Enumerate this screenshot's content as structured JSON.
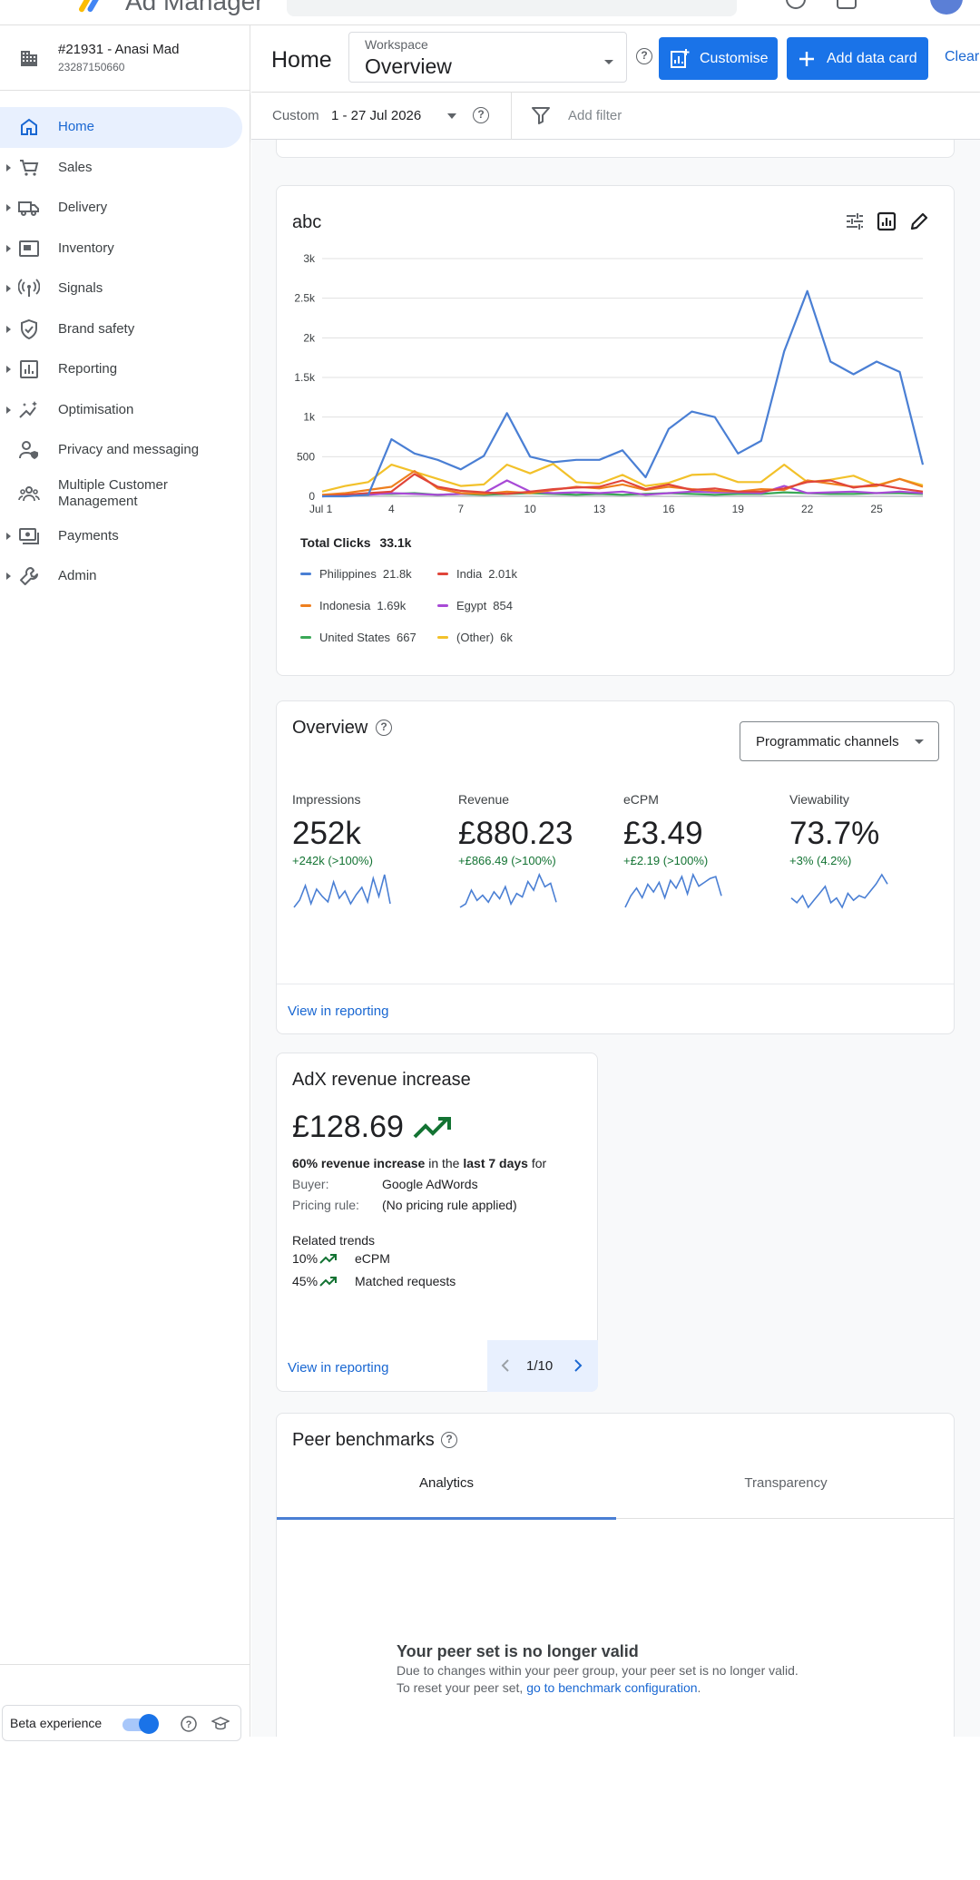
{
  "topbar": {
    "brand": "Ad Manager"
  },
  "account": {
    "name": "#21931 - Anasi Mad",
    "number": "23287150660"
  },
  "sidebar": {
    "items": [
      {
        "label": "Home",
        "icon": "home-icon",
        "active": true
      },
      {
        "label": "Sales",
        "icon": "cart-icon"
      },
      {
        "label": "Delivery",
        "icon": "truck-icon"
      },
      {
        "label": "Inventory",
        "icon": "inventory-icon"
      },
      {
        "label": "Signals",
        "icon": "signal-icon"
      },
      {
        "label": "Brand safety",
        "icon": "shield-icon"
      },
      {
        "label": "Reporting",
        "icon": "reporting-icon"
      },
      {
        "label": "Optimisation",
        "icon": "sparkle-icon"
      },
      {
        "label": "Privacy and messaging",
        "icon": "privacy-icon"
      },
      {
        "label": "Multiple Customer Management",
        "icon": "people-icon"
      },
      {
        "label": "Payments",
        "icon": "payments-icon"
      },
      {
        "label": "Admin",
        "icon": "wrench-icon"
      }
    ],
    "beta_label": "Beta experience"
  },
  "header": {
    "title": "Home",
    "workspace_label": "Workspace",
    "workspace_value": "Overview",
    "customise_label": "Customise",
    "add_card_label": "Add data card",
    "clear_label": "Clear"
  },
  "filters": {
    "range_type": "Custom",
    "range_value": "1 - 27 Jul 2026",
    "add_filter": "Add filter"
  },
  "chart_card": {
    "title": "abc",
    "total_label": "Total Clicks",
    "total_value": "33.1k",
    "legend": [
      {
        "name": "Philippines",
        "value": "21.8k",
        "color": "#4a7fd4"
      },
      {
        "name": "India",
        "value": "2.01k",
        "color": "#e0453a"
      },
      {
        "name": "Indonesia",
        "value": "1.69k",
        "color": "#ee7f1f"
      },
      {
        "name": "Egypt",
        "value": "854",
        "color": "#a84ad6"
      },
      {
        "name": "United States",
        "value": "667",
        "color": "#3aa857"
      },
      {
        "name": "(Other)",
        "value": "6k",
        "color": "#f2c12a"
      }
    ]
  },
  "chart_data": {
    "type": "line",
    "x": [
      1,
      2,
      3,
      4,
      5,
      6,
      7,
      8,
      9,
      10,
      11,
      12,
      13,
      14,
      15,
      16,
      17,
      18,
      19,
      20,
      21,
      22,
      23,
      24,
      25,
      26,
      27
    ],
    "xticks": [
      1,
      4,
      7,
      10,
      13,
      16,
      19,
      22,
      25
    ],
    "xtick_labels": [
      "Jul 1",
      "4",
      "7",
      "10",
      "13",
      "16",
      "19",
      "22",
      "25"
    ],
    "yticks": [
      0,
      500,
      1000,
      1500,
      2000,
      2500,
      3000
    ],
    "ytick_labels": [
      "0",
      "500",
      "1k",
      "1.5k",
      "2k",
      "2.5k",
      "3k"
    ],
    "ylim": [
      0,
      3000
    ],
    "xlim": [
      1,
      27
    ],
    "grid": true,
    "series": [
      {
        "name": "Philippines",
        "color": "#4a7fd4",
        "values": [
          0,
          0,
          20,
          720,
          540,
          460,
          340,
          510,
          1050,
          500,
          430,
          460,
          460,
          580,
          240,
          850,
          1070,
          1000,
          540,
          700,
          1830,
          2590,
          1700,
          1540,
          1700,
          1570,
          400
        ]
      },
      {
        "name": "India",
        "color": "#e0453a",
        "values": [
          0,
          20,
          40,
          60,
          280,
          120,
          70,
          50,
          30,
          60,
          90,
          110,
          120,
          200,
          90,
          150,
          80,
          100,
          60,
          60,
          100,
          180,
          200,
          110,
          150,
          100,
          60
        ]
      },
      {
        "name": "Indonesia",
        "color": "#ee7f1f",
        "values": [
          20,
          40,
          80,
          120,
          320,
          100,
          40,
          30,
          60,
          40,
          80,
          120,
          100,
          150,
          80,
          120,
          90,
          70,
          60,
          90,
          80,
          200,
          160,
          120,
          130,
          220,
          120
        ]
      },
      {
        "name": "Egypt",
        "color": "#a84ad6",
        "values": [
          0,
          10,
          20,
          40,
          30,
          20,
          30,
          40,
          200,
          60,
          40,
          50,
          40,
          60,
          20,
          40,
          60,
          50,
          50,
          40,
          130,
          40,
          50,
          60,
          40,
          60,
          40
        ]
      },
      {
        "name": "United States",
        "color": "#3aa857",
        "values": [
          10,
          20,
          30,
          30,
          40,
          20,
          30,
          20,
          30,
          40,
          30,
          20,
          30,
          20,
          30,
          40,
          30,
          20,
          30,
          30,
          50,
          40,
          30,
          30,
          40,
          40,
          30
        ]
      },
      {
        "name": "(Other)",
        "color": "#f2c12a",
        "values": [
          60,
          130,
          180,
          400,
          310,
          220,
          130,
          150,
          400,
          290,
          410,
          180,
          160,
          270,
          130,
          170,
          270,
          280,
          180,
          180,
          400,
          180,
          210,
          260,
          140,
          220,
          140
        ]
      }
    ]
  },
  "overview": {
    "title": "Overview",
    "dropdown": "Programmatic channels",
    "metrics": [
      {
        "label": "Impressions",
        "value": "252k",
        "delta": "+242k (>100%)",
        "spark": [
          10,
          14,
          22,
          12,
          20,
          16,
          13,
          24,
          15,
          19,
          12,
          17,
          21,
          13,
          26,
          16,
          28,
          12
        ]
      },
      {
        "label": "Revenue",
        "value": "£880.23",
        "delta": "+£866.49 (>100%)",
        "spark": [
          10,
          12,
          20,
          14,
          17,
          13,
          19,
          15,
          22,
          12,
          18,
          16,
          25,
          20,
          29,
          22,
          24,
          13
        ]
      },
      {
        "label": "eCPM",
        "value": "£3.49",
        "delta": "+£2.19 (>100%)",
        "spark": [
          8,
          14,
          18,
          13,
          20,
          16,
          21,
          13,
          22,
          18,
          24,
          15,
          25,
          19,
          21,
          23,
          24,
          14
        ]
      },
      {
        "label": "Viewability",
        "value": "73.7%",
        "delta": "+3% (4.2%)",
        "spark": [
          16,
          14,
          17,
          12,
          15,
          18,
          21,
          14,
          16,
          12,
          18,
          15,
          17,
          16,
          19,
          22,
          26,
          22
        ]
      }
    ],
    "view_link": "View in reporting"
  },
  "adx": {
    "title": "AdX revenue increase",
    "value": "£128.69",
    "sentence_bold1": "60% revenue increase",
    "sentence_mid": " in the ",
    "sentence_bold2": "last 7 days",
    "sentence_end": " for",
    "buyer_label": "Buyer:",
    "buyer_value": "Google AdWords",
    "pricing_label": "Pricing rule:",
    "pricing_value": "(No pricing rule applied)",
    "related_title": "Related trends",
    "trends": [
      {
        "pct": "10%",
        "label": "eCPM"
      },
      {
        "pct": "45%",
        "label": "Matched requests"
      }
    ],
    "view_link": "View in reporting",
    "pager": "1/10"
  },
  "peer": {
    "title": "Peer benchmarks",
    "tabs": [
      "Analytics",
      "Transparency"
    ],
    "msg_title": "Your peer set is no longer valid",
    "msg_line1": "Due to changes within your peer group, your peer set is no longer valid.",
    "msg_line2_pre": "To reset your peer set, ",
    "msg_link": "go to benchmark configuration",
    "msg_line2_post": "."
  },
  "colors": {
    "accent": "#1a73e8",
    "link": "#1967d2",
    "positive": "#137333"
  }
}
